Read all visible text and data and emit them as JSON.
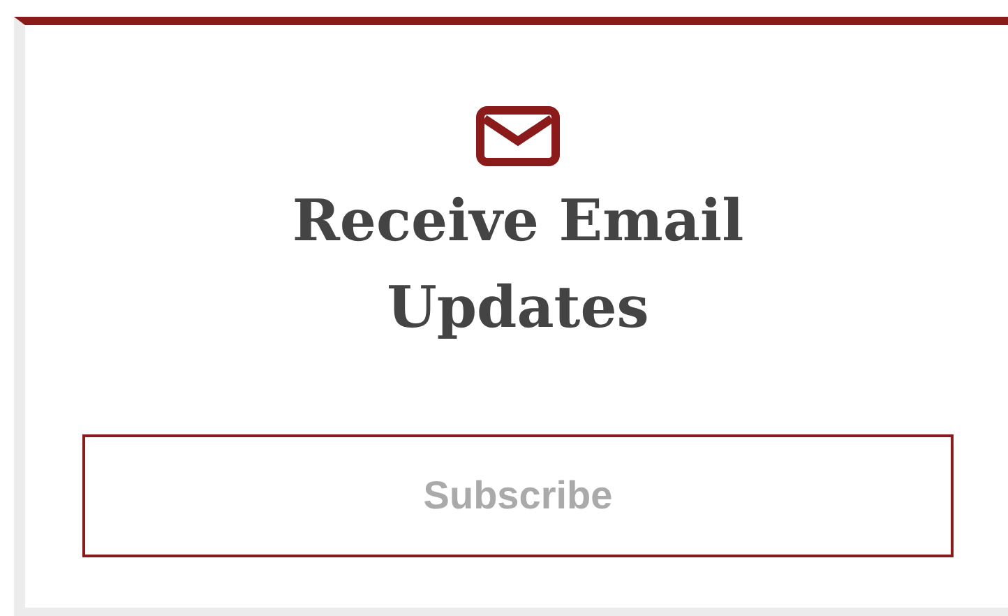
{
  "card": {
    "title": "Receive Email Updates",
    "button": {
      "label": "Subscribe"
    }
  }
}
